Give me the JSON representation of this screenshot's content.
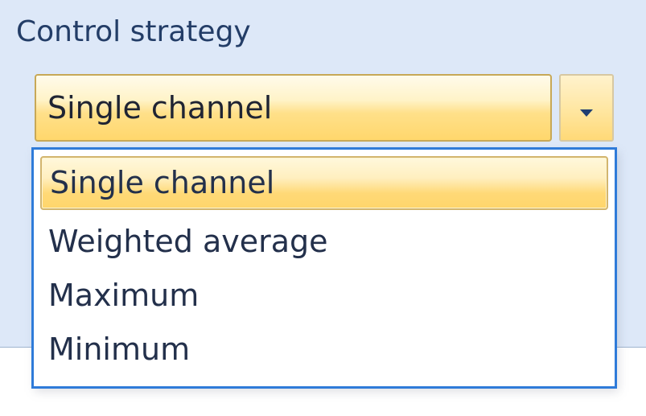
{
  "group": {
    "title": "Control strategy"
  },
  "combo": {
    "selected_value": "Single channel",
    "options": [
      "Single channel",
      "Weighted average",
      "Maximum",
      "Minimum"
    ]
  },
  "colors": {
    "panel_background": "#dde8f8",
    "selection_gold": "#ffd76c",
    "dropdown_border": "#2f7bd9",
    "text": "#23304b"
  },
  "icons": {
    "combo_arrow": "chevron-down-icon"
  }
}
